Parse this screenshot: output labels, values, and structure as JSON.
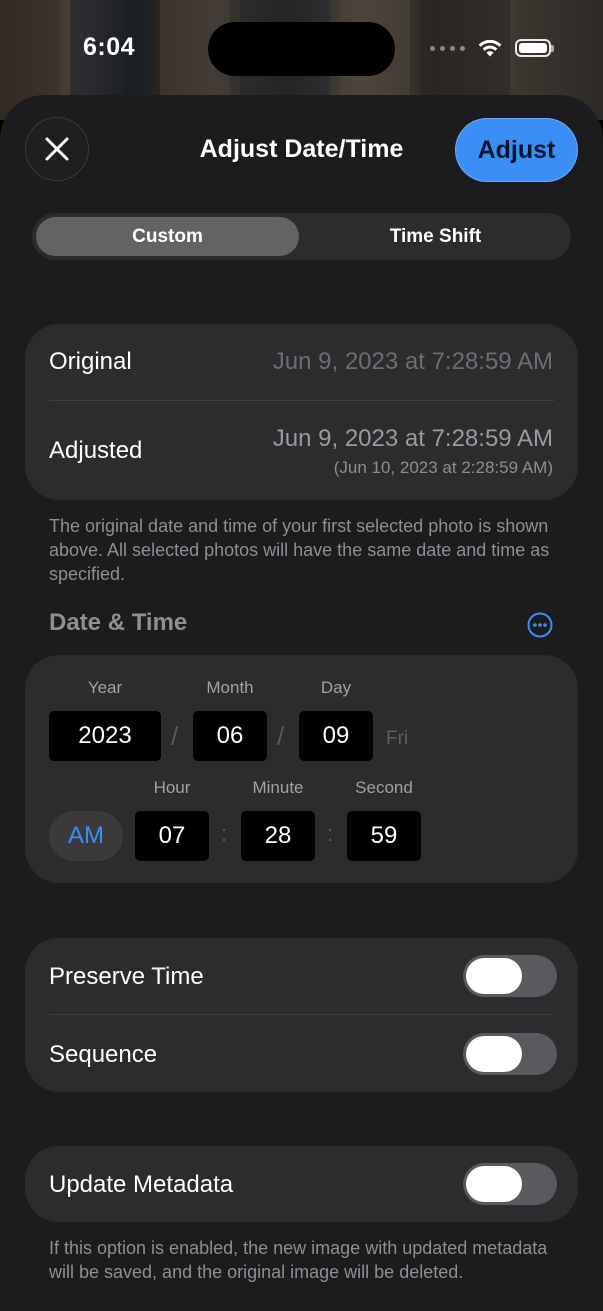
{
  "status_bar": {
    "time": "6:04"
  },
  "header": {
    "title": "Adjust Date/Time",
    "close_icon": "xmark",
    "adjust_label": "Adjust",
    "accent_color": "#3a8ef5"
  },
  "segments": {
    "custom": "Custom",
    "time_shift": "Time Shift",
    "selected": "Custom"
  },
  "dates": {
    "original_label": "Original",
    "original_value": "Jun 9, 2023 at 7:28:59 AM",
    "adjusted_label": "Adjusted",
    "adjusted_value": "Jun 9, 2023 at 7:28:59 AM",
    "adjusted_sub": "(Jun 10, 2023 at 2:28:59 AM)"
  },
  "dates_caption": "The original date and time of your first selected photo is shown above. All selected photos will have the same date and time as specified.",
  "date_time": {
    "section_title": "Date & Time",
    "more_icon": "ellipsis-circle",
    "year_label": "Year",
    "month_label": "Month",
    "day_label": "Day",
    "year": "2023",
    "month": "06",
    "day": "09",
    "date_sep": "/",
    "weekday": "Fri",
    "hour_label": "Hour",
    "minute_label": "Minute",
    "second_label": "Second",
    "ampm": "AM",
    "hour": "07",
    "minute": "28",
    "second": "59",
    "time_sep": ":"
  },
  "options": {
    "preserve_time_label": "Preserve Time",
    "preserve_time_on": false,
    "sequence_label": "Sequence",
    "sequence_on": false
  },
  "metadata": {
    "label": "Update Metadata",
    "on": false,
    "caption": "If this option is enabled, the new image with updated metadata will be saved, and the original image will be deleted."
  }
}
